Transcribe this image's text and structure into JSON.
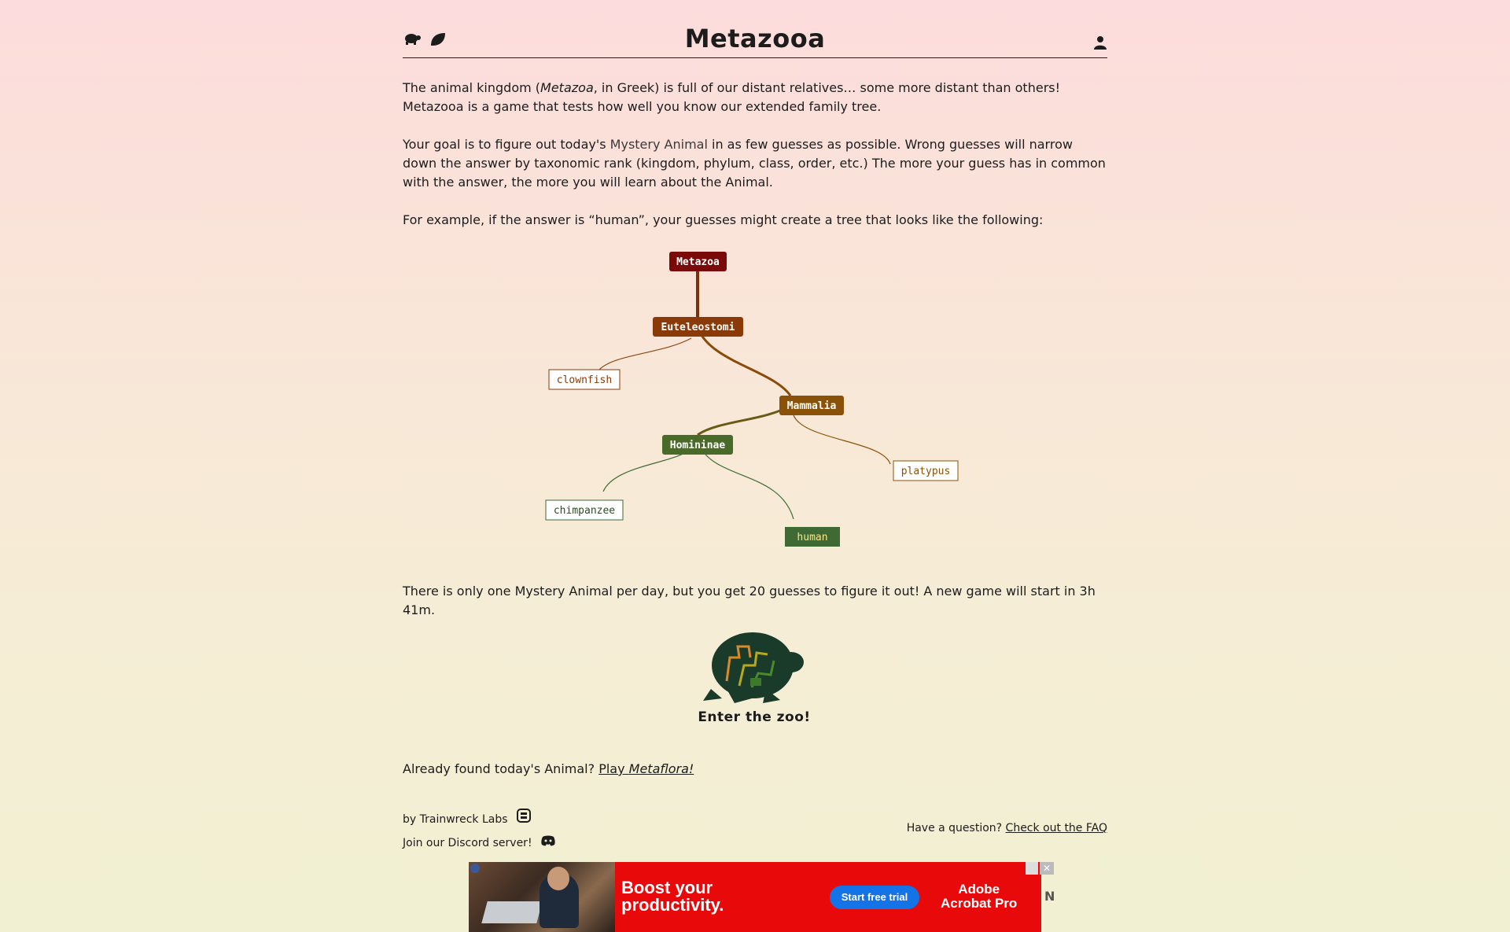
{
  "header": {
    "title": "Metazooa",
    "icons": [
      "turtle-icon",
      "leaf-icon",
      "user-icon"
    ]
  },
  "intro": {
    "p1_before": "The animal kingdom (",
    "p1_italic": "Metazoa",
    "p1_after": ", in Greek) is full of our distant relatives… some more distant than others! Metazooa is a game that tests how well you know our extended family tree.",
    "p2_before": "Your goal is to figure out today's ",
    "p2_mystery": "Mystery Animal",
    "p2_after": " in as few guesses as possible. Wrong guesses will narrow down the answer by taxonomic rank (kingdom, phylum, class, order, etc.) The more your guess has in common with the answer, the more you will learn about the Animal.",
    "p3": "For example, if the answer is “human”, your guesses might create a tree that looks like the following:"
  },
  "tree": {
    "nodes": {
      "metazoa": "Metazoa",
      "euteleostomi": "Euteleostomi",
      "clownfish": "clownfish",
      "mammalia": "Mammalia",
      "homininae": "Homininae",
      "platypus": "platypus",
      "chimpanzee": "chimpanzee",
      "human": "human"
    },
    "colors": {
      "metazoa": "#7a0a0a",
      "euteleostomi": "#8a3a08",
      "mammalia": "#8a5208",
      "homininae": "#4a6a2a",
      "human": "#3f6a34"
    }
  },
  "daily": {
    "text": "There is only one Mystery Animal per day, but you get 20 guesses to figure it out! A new game will start in 3h 41m."
  },
  "logo": {
    "caption": "Enter the zoo!"
  },
  "already": {
    "text": "Already found today's Animal? ",
    "link_play": "Play ",
    "link_italic": "Metaflora!"
  },
  "footer": {
    "by": "by Trainwreck Labs",
    "discord": "Join our Discord server!",
    "question": "Have a question? ",
    "faq_link": "Check out the FAQ"
  },
  "ad": {
    "headline_1": "Boost your",
    "headline_2": "productivity.",
    "button": "Start free trial",
    "brand_1": "Adobe",
    "brand_2": "Acrobat Pro",
    "close": "✕"
  }
}
